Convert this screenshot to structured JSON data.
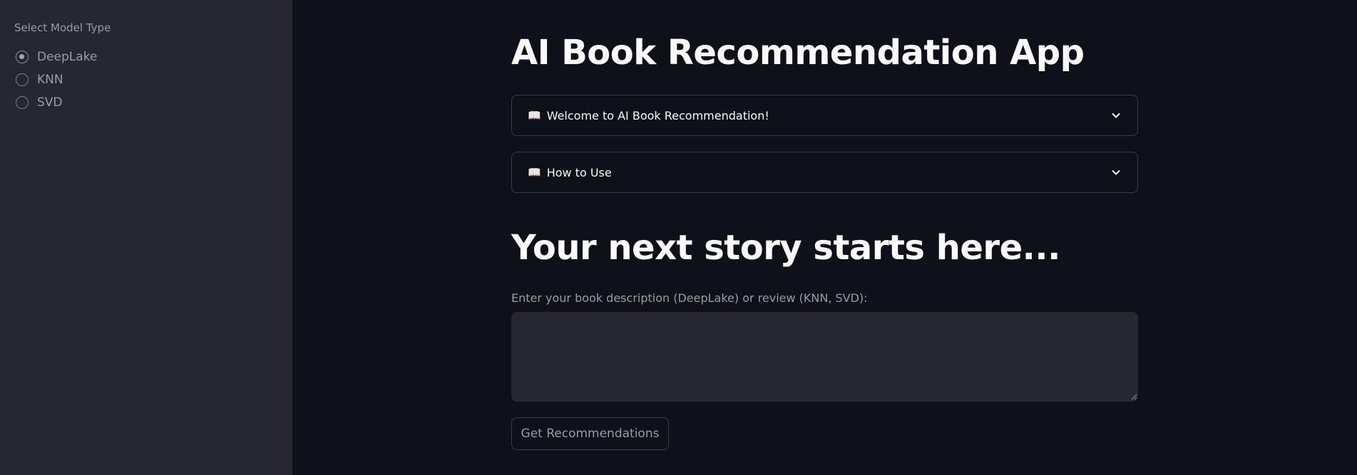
{
  "sidebar": {
    "label": "Select Model Type",
    "options": [
      {
        "label": "DeepLake",
        "selected": true
      },
      {
        "label": "KNN",
        "selected": false
      },
      {
        "label": "SVD",
        "selected": false
      }
    ]
  },
  "main": {
    "title": "AI Book Recommendation App",
    "expanders": [
      {
        "icon": "open-book-icon",
        "glyph": "📖",
        "label": "Welcome to AI Book Recommendation!"
      },
      {
        "icon": "open-book-icon",
        "glyph": "📖",
        "label": "How to Use"
      }
    ],
    "subheading": "Your next story starts here...",
    "input": {
      "label": "Enter your book description (DeepLake) or review (KNN, SVD):",
      "value": "",
      "placeholder": ""
    },
    "button_label": "Get Recommendations"
  },
  "colors": {
    "background": "#0e1117",
    "sidebar": "#262730",
    "text": "#fafafa",
    "muted": "#9a9ba3",
    "border": "#3a3b44"
  }
}
